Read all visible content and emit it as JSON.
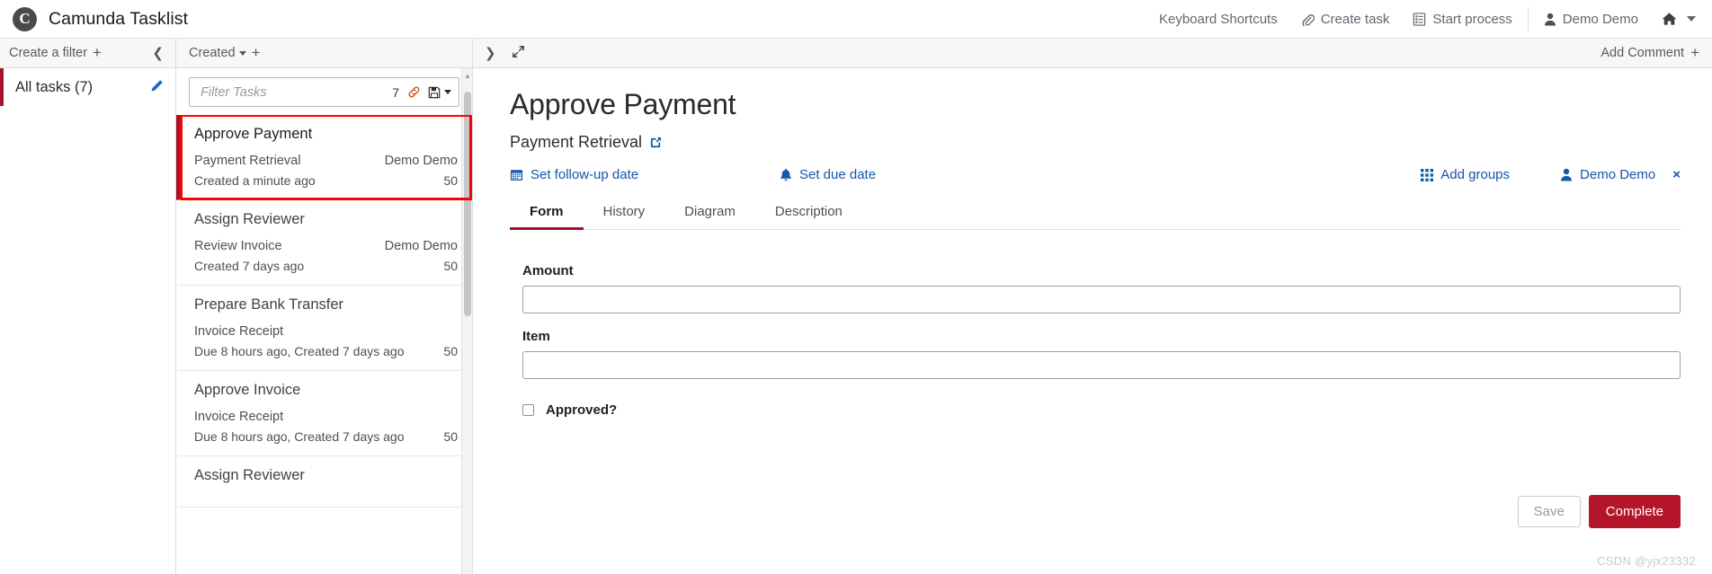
{
  "header": {
    "brand_logo_glyph": "C",
    "brand_logo_name": "camunda-logo-icon",
    "title": "Camunda Tasklist",
    "nav": [
      {
        "label": "Keyboard Shortcuts",
        "icon": ""
      },
      {
        "label": "Create task",
        "icon": "paperclip-icon"
      },
      {
        "label": "Start process",
        "icon": "list-document-icon"
      },
      {
        "label": "Demo Demo",
        "icon": "user-icon"
      }
    ],
    "home_icon": "home-icon"
  },
  "filters": {
    "head_label": "Create a filter",
    "head_plus": "+",
    "collapse_icon": "chevron-left-icon",
    "items": [
      {
        "label": "All tasks (7)",
        "edit_icon": "pencil-icon",
        "selected": true
      }
    ]
  },
  "tasklist": {
    "sort_label": "Created",
    "add_label": "+",
    "collapse_icon": "chevron-left-icon",
    "search": {
      "placeholder": "Filter Tasks",
      "value": "",
      "count": "7",
      "link_icon": "chain-link-icon",
      "save_icon": "floppy-disk-icon"
    },
    "tasks": [
      {
        "title": "Approve Payment",
        "process": "Payment Retrieval",
        "time": "Created a minute ago",
        "assignee": "Demo Demo",
        "priority": "50",
        "selected": true
      },
      {
        "title": "Assign Reviewer",
        "process": "Review Invoice",
        "time": "Created 7 days ago",
        "assignee": "Demo Demo",
        "priority": "50",
        "selected": false
      },
      {
        "title": "Prepare Bank Transfer",
        "process": "Invoice Receipt",
        "time": "Due 8 hours ago, Created 7 days ago",
        "assignee": "",
        "priority": "50",
        "selected": false
      },
      {
        "title": "Approve Invoice",
        "process": "Invoice Receipt",
        "time": "Due 8 hours ago, Created 7 days ago",
        "assignee": "",
        "priority": "50",
        "selected": false
      },
      {
        "title": "Assign Reviewer",
        "process": "",
        "time": "",
        "assignee": "",
        "priority": "",
        "selected": false
      }
    ]
  },
  "detail": {
    "expand_icon": "chevron-right-icon",
    "fullscreen_icon": "expand-arrows-icon",
    "add_comment_label": "Add Comment",
    "add_comment_plus": "+",
    "title": "Approve Payment",
    "process_name": "Payment Retrieval",
    "process_link_icon": "external-link-icon",
    "actions": {
      "follow_up": {
        "label": "Set follow-up date",
        "icon": "calendar-icon"
      },
      "due": {
        "label": "Set due date",
        "icon": "bell-icon"
      },
      "groups": {
        "label": "Add groups",
        "icon": "grid-icon"
      },
      "assignee": {
        "label": "Demo Demo",
        "icon": "user-icon",
        "remove": "×"
      }
    },
    "tabs": [
      {
        "label": "Form",
        "active": true
      },
      {
        "label": "History",
        "active": false
      },
      {
        "label": "Diagram",
        "active": false
      },
      {
        "label": "Description",
        "active": false
      }
    ],
    "form": {
      "fields": [
        {
          "label": "Amount",
          "value": "",
          "placeholder": ""
        },
        {
          "label": "Item",
          "value": "",
          "placeholder": ""
        }
      ],
      "checkbox": {
        "label": "Approved?",
        "checked": false
      }
    },
    "buttons": {
      "save": "Save",
      "complete": "Complete"
    }
  },
  "watermark": "CSDN @yjx23332",
  "colors": {
    "brand_red": "#a8112b",
    "complete_red": "#b5152b",
    "link_blue": "#1757a8",
    "annotation_red": "#f90404"
  }
}
